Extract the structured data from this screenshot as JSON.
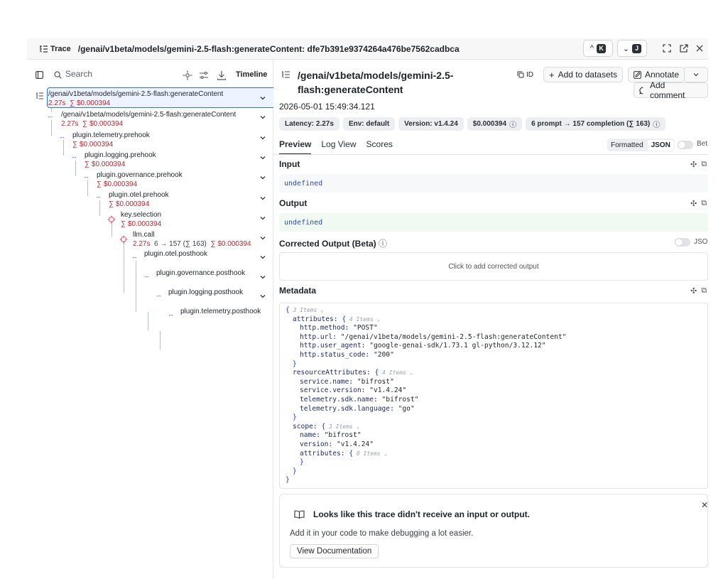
{
  "header": {
    "trace_label": "Trace",
    "trace_title": "/genai/v1beta/models/gemini-2.5-flash:generateContent: dfe7b391e9374264a476be7562cadbca",
    "prev_key": "K",
    "next_key": "J"
  },
  "left": {
    "search_placeholder": "Search",
    "timeline_label": "Timeline",
    "nodes": [
      {
        "name": "/genai/v1beta/models/gemini-2.5-flash:generateContent",
        "time": "2.27s",
        "cost": "∑ $0.000394"
      },
      {
        "name": "/genai/v1beta/models/gemini-2.5-flash:generateContent",
        "time": "2.27s",
        "cost": "∑ $0.000394"
      },
      {
        "name": "plugin.telemetry.prehook",
        "cost": "∑ $0.000394"
      },
      {
        "name": "plugin.logging.prehook",
        "cost": "∑ $0.000394"
      },
      {
        "name": "plugin.governance.prehook",
        "cost": "∑ $0.000394"
      },
      {
        "name": "plugin.otel.prehook",
        "cost": "∑ $0.000394"
      },
      {
        "name": "key.selection",
        "cost": "∑ $0.000394"
      },
      {
        "name": "llm.call",
        "time": "2.27s",
        "tokens": "6 → 157 (∑ 163)",
        "cost": "∑ $0.000394"
      },
      {
        "name": "plugin.otel.posthook"
      },
      {
        "name": "plugin.governance.posthook"
      },
      {
        "name": "plugin.logging.posthook"
      },
      {
        "name": "plugin.telemetry.posthook"
      }
    ]
  },
  "span": {
    "title": "/genai/v1beta/models/gemini-2.5-flash:generateContent",
    "id_label": "ID",
    "add_to_datasets": "Add to datasets",
    "annotate": "Annotate",
    "add_comment": "Add comment",
    "timestamp": "2026-05-01 15:49:34.121",
    "badges": {
      "latency": "Latency: 2.27s",
      "env": "Env: default",
      "version": "Version: v1.4.24",
      "cost": "$0.000394",
      "tokens": "6 prompt → 157 completion (∑ 163)"
    },
    "tabs": [
      "Preview",
      "Log View",
      "Scores"
    ],
    "formatted_label": "Formatted",
    "json_label": "JSON",
    "beta_label": "Bet",
    "input_label": "Input",
    "input_value": "undefined",
    "output_label": "Output",
    "output_value": "undefined",
    "corrected_label": "Corrected Output (Beta)",
    "corrected_json_label": "JSO",
    "corrected_placeholder": "Click to add corrected output",
    "metadata_label": "Metadata"
  },
  "metadata_tree": [
    {
      "indent": 0,
      "text": "{",
      "count": "3 Items"
    },
    {
      "indent": 1,
      "key": "attributes",
      "text": "{",
      "count": "4 Items"
    },
    {
      "indent": 2,
      "key": "http.method",
      "value": "\"POST\""
    },
    {
      "indent": 2,
      "key": "http.url",
      "value": "\"/genai/v1beta/models/gemini-2.5-flash:generateContent\""
    },
    {
      "indent": 2,
      "key": "http.user_agent",
      "value": "\"google-genai-sdk/1.73.1 gl-python/3.12.12\""
    },
    {
      "indent": 2,
      "key": "http.status_code",
      "value": "\"200\""
    },
    {
      "indent": 1,
      "text": "}"
    },
    {
      "indent": 1,
      "key": "resourceAttributes",
      "text": "{",
      "count": "4 Items"
    },
    {
      "indent": 2,
      "key": "service.name",
      "value": "\"bifrost\""
    },
    {
      "indent": 2,
      "key": "service.version",
      "value": "\"v1.4.24\""
    },
    {
      "indent": 2,
      "key": "telemetry.sdk.name",
      "value": "\"bifrost\""
    },
    {
      "indent": 2,
      "key": "telemetry.sdk.language",
      "value": "\"go\""
    },
    {
      "indent": 1,
      "text": "}"
    },
    {
      "indent": 1,
      "key": "scope",
      "text": "{",
      "count": "3 Items"
    },
    {
      "indent": 2,
      "key": "name",
      "value": "\"bifrost\""
    },
    {
      "indent": 2,
      "key": "version",
      "value": "\"v1.4.24\""
    },
    {
      "indent": 2,
      "key": "attributes",
      "text": "{",
      "count": "0 Items"
    },
    {
      "indent": 2,
      "text": "}"
    },
    {
      "indent": 1,
      "text": "}"
    },
    {
      "indent": 0,
      "text": "}"
    }
  ],
  "empty_card": {
    "message": "Looks like this trace didn't receive an input or output.",
    "sub": "Add it in your code to make debugging a lot easier.",
    "button": "View Documentation"
  },
  "colors": {
    "accent_blue": "#2f6fe4",
    "cost_red": "#c4262e",
    "output_green": "#f0faf3",
    "input_gray": "#f7f8fa"
  }
}
